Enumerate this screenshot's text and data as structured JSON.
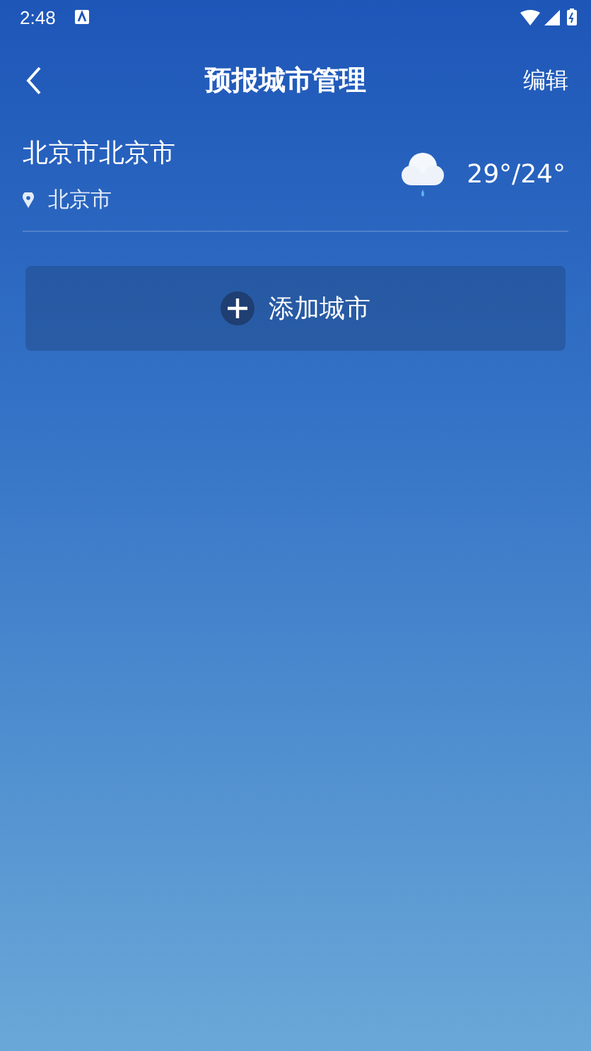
{
  "status_bar": {
    "time": "2:48"
  },
  "header": {
    "title": "预报城市管理",
    "action": "编辑"
  },
  "cities": [
    {
      "name": "北京市北京市",
      "location": "北京市",
      "kind": "rain",
      "temperature": "29°/24°"
    }
  ],
  "add_button": {
    "label": "添加城市"
  }
}
